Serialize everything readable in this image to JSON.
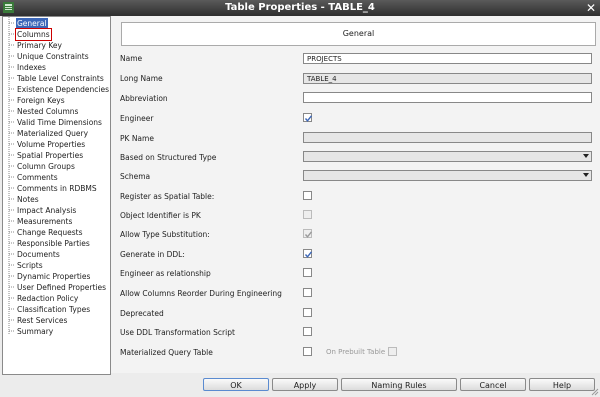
{
  "window": {
    "title": "Table Properties - TABLE_4"
  },
  "nav": {
    "items": [
      {
        "label": "General",
        "state": "selected"
      },
      {
        "label": "Columns",
        "state": "focused"
      },
      {
        "label": "Primary Key"
      },
      {
        "label": "Unique Constraints"
      },
      {
        "label": "Indexes"
      },
      {
        "label": "Table Level Constraints"
      },
      {
        "label": "Existence Dependencies"
      },
      {
        "label": "Foreign Keys"
      },
      {
        "label": "Nested Columns"
      },
      {
        "label": "Valid Time Dimensions"
      },
      {
        "label": "Materialized Query"
      },
      {
        "label": "Volume Properties"
      },
      {
        "label": "Spatial Properties"
      },
      {
        "label": "Column Groups"
      },
      {
        "label": "Comments"
      },
      {
        "label": "Comments in RDBMS"
      },
      {
        "label": "Notes"
      },
      {
        "label": "Impact Analysis"
      },
      {
        "label": "Measurements"
      },
      {
        "label": "Change Requests"
      },
      {
        "label": "Responsible Parties"
      },
      {
        "label": "Documents"
      },
      {
        "label": "Scripts"
      },
      {
        "label": "Dynamic Properties"
      },
      {
        "label": "User Defined Properties"
      },
      {
        "label": "Redaction Policy"
      },
      {
        "label": "Classification Types"
      },
      {
        "label": "Rest Services"
      },
      {
        "label": "Summary"
      }
    ]
  },
  "form": {
    "section_title": "General",
    "name": {
      "label": "Name",
      "value": "PROJECTS"
    },
    "long_name": {
      "label": "Long Name",
      "value": "TABLE_4"
    },
    "abbreviation": {
      "label": "Abbreviation",
      "value": ""
    },
    "engineer": {
      "label": "Engineer",
      "checked": true
    },
    "pk_name": {
      "label": "PK Name",
      "value": ""
    },
    "structured_type": {
      "label": "Based on Structured Type",
      "value": ""
    },
    "schema": {
      "label": "Schema",
      "value": ""
    },
    "register_spatial": {
      "label": "Register as Spatial Table:",
      "checked": false
    },
    "object_identifier_pk": {
      "label": "Object Identifier is PK",
      "checked": false,
      "disabled": true
    },
    "allow_type_substitution": {
      "label": "Allow Type Substitution:",
      "checked": true,
      "disabled": true
    },
    "generate_in_ddl": {
      "label": "Generate in DDL:",
      "checked": true
    },
    "engineer_as_relationship": {
      "label": "Engineer as relationship",
      "checked": false
    },
    "allow_columns_reorder": {
      "label": "Allow Columns Reorder During Engineering",
      "checked": false
    },
    "deprecated": {
      "label": "Deprecated",
      "checked": false
    },
    "use_ddl_transformation": {
      "label": "Use DDL Transformation Script",
      "checked": false
    },
    "materialized_query_table": {
      "label": "Materialized Query Table",
      "checked": false
    },
    "on_prebuilt_table": {
      "label": "On Prebuilt Table",
      "checked": false
    }
  },
  "buttons": {
    "ok": "OK",
    "apply": "Apply",
    "naming_rules": "Naming Rules",
    "cancel": "Cancel",
    "help": "Help"
  },
  "colors": {
    "selection": "#3c67b8",
    "focus_outline": "#cc0000",
    "check": "#3c67b8"
  },
  "icons": [
    "app-icon",
    "close-icon",
    "check-icon",
    "dropdown-arrow-icon",
    "resize-grip-icon"
  ]
}
